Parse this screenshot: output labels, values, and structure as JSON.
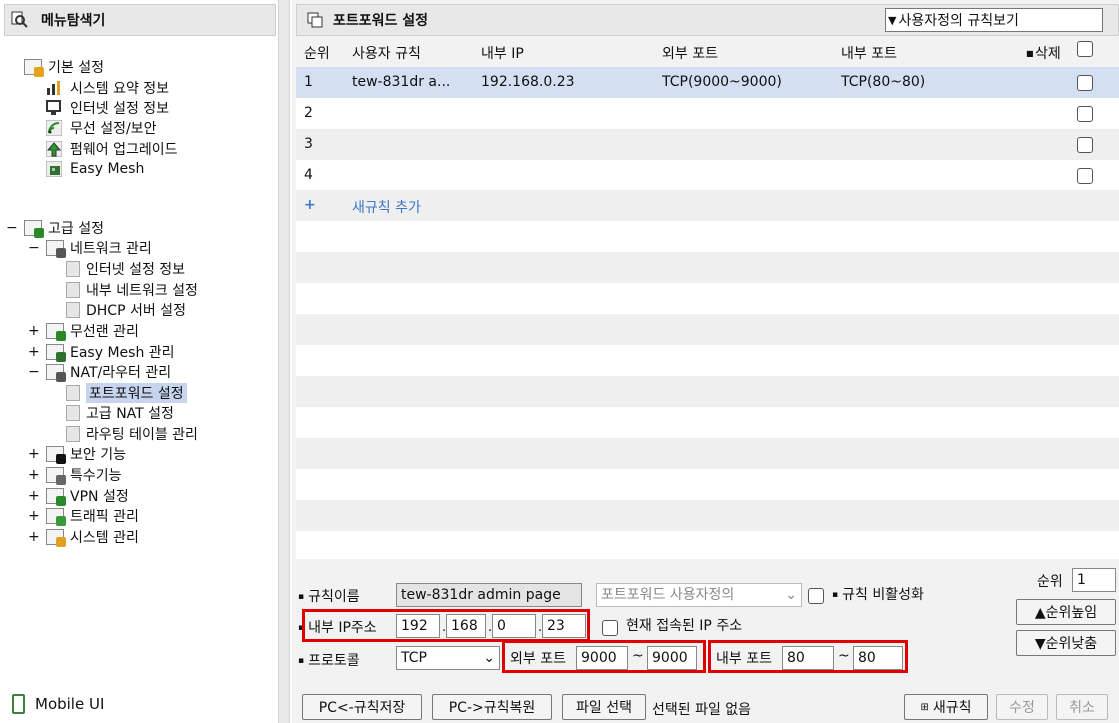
{
  "left": {
    "title": "메뉴탐색기",
    "basic": {
      "label": "기본 설정",
      "items": [
        "시스템 요약 정보",
        "인터넷 설정 정보",
        "무선 설정/보안",
        "펌웨어 업그레이드",
        "Easy Mesh"
      ]
    },
    "advanced": {
      "label": "고급 설정",
      "network": {
        "label": "네트워크 관리",
        "items": [
          "인터넷 설정 정보",
          "내부 네트워크 설정",
          "DHCP 서버 설정"
        ]
      },
      "wireless": "무선랜 관리",
      "easymesh": "Easy Mesh 관리",
      "nat": {
        "label": "NAT/라우터 관리",
        "items": [
          "포트포워드 설정",
          "고급 NAT 설정",
          "라우팅 테이블 관리"
        ]
      },
      "security": "보안 기능",
      "special": "특수기능",
      "vpn": "VPN 설정",
      "traffic": "트래픽 관리",
      "system": "시스템 관리"
    },
    "mobile_ui": "Mobile UI",
    "expander_minus": "−",
    "expander_plus": "+"
  },
  "right": {
    "title": "포트포워드 설정",
    "view_select": "사용자정의 규칙보기",
    "columns": {
      "seq": "순위",
      "rule": "사용자 규칙",
      "ip": "내부 IP",
      "ext": "외부 포트",
      "int": "내부 포트",
      "del": "삭제"
    },
    "rows": [
      {
        "seq": "1",
        "rule": "tew-831dr a...",
        "ip": "192.168.0.23",
        "ext": "TCP(9000~9000)",
        "int": "TCP(80~80)"
      },
      {
        "seq": "2",
        "rule": "",
        "ip": "",
        "ext": "",
        "int": ""
      },
      {
        "seq": "3",
        "rule": "",
        "ip": "",
        "ext": "",
        "int": ""
      },
      {
        "seq": "4",
        "rule": "",
        "ip": "",
        "ext": "",
        "int": ""
      }
    ],
    "add_plus": "+",
    "add_label": "새규칙 추가"
  },
  "form": {
    "rule_name_label": "규칙이름",
    "rule_name_value": "tew-831dr admin page",
    "preset_select": "포트포워드 사용자정의",
    "disable_label": "규칙 비활성화",
    "ip_label": "내부 IP주소",
    "ip": [
      "192",
      "168",
      "0",
      "23"
    ],
    "current_ip_label": "현재 접속된 IP 주소",
    "protocol_label": "프로토콜",
    "protocol_value": "TCP",
    "ext_port_label": "외부 포트",
    "ext_port_from": "9000",
    "ext_port_to": "9000",
    "int_port_label": "내부 포트",
    "int_port_from": "80",
    "int_port_to": "80",
    "tilde": "~",
    "rank_label": "순위",
    "rank_value": "1",
    "rank_up": "▲순위높임",
    "rank_down": "▼순위낮춤"
  },
  "buttons": {
    "pc_save": "PC<-규칙저장",
    "pc_restore": "PC->규칙복원",
    "file_select": "파일 선택",
    "file_status": "선택된 파일 없음",
    "new_rule": "새규칙",
    "modify": "수정",
    "cancel": "취소"
  },
  "colors": {
    "highlight_red": "#e00000",
    "link_blue": "#3b78c7",
    "selected_row": "#d4dff2"
  }
}
